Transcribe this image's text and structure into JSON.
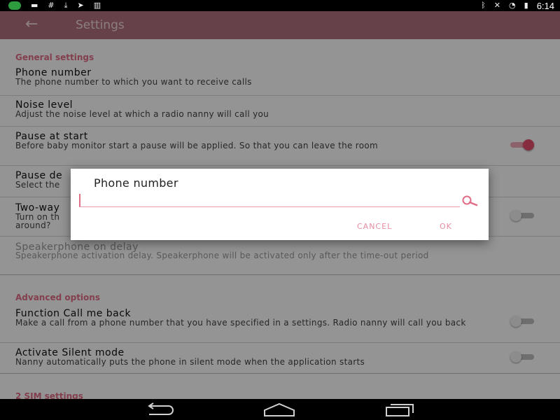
{
  "status_bar": {
    "time": "6:14",
    "left_icons": [
      "app-notification-icon",
      "message-icon",
      "hash-icon",
      "download-icon",
      "send-icon",
      "barcode-icon"
    ],
    "right_icons": [
      "bluetooth-icon",
      "mute-icon",
      "wifi-icon",
      "battery-icon"
    ]
  },
  "app_bar": {
    "title": "Settings",
    "back_icon": "arrow-left-icon"
  },
  "general": {
    "header": "General settings",
    "phone": {
      "title": "Phone number",
      "summary": "The phone number to which you want to receive calls"
    },
    "noise": {
      "title": "Noise level",
      "summary": "Adjust the noise level at which a radio nanny will call you"
    },
    "pause": {
      "title": "Pause at start",
      "summary": "Before baby monitor start a pause will be applied. So that you can leave the room",
      "enabled": true
    },
    "pause_delay": {
      "title": "Pause de",
      "summary": "Select the"
    },
    "two_way": {
      "title": "Two-way",
      "summary": "Turn on th\naround?",
      "enabled": false
    },
    "speaker": {
      "title": "Speakerphone on delay",
      "summary": "Speakerphone activation delay. Speakerphone will be activated only after the time-out period"
    }
  },
  "advanced": {
    "header": "Advanced options",
    "call_back": {
      "title": "Function Call me back",
      "summary": "Make a call from a phone number that you have specified in a settings. Radio nanny will call you back",
      "enabled": false
    },
    "silent": {
      "title": "Activate Silent mode",
      "summary": "Nanny automatically puts the phone in silent mode when the application starts",
      "enabled": false
    }
  },
  "sim": {
    "header": "2 SIM settings"
  },
  "dialog": {
    "title": "Phone number",
    "input_value": "",
    "cancel_label": "CANCEL",
    "ok_label": "OK",
    "search_icon": "search-icon"
  },
  "nav_bar": {
    "icons": [
      "back-icon",
      "home-icon",
      "recents-icon"
    ]
  },
  "colors": {
    "accent": "#e26d86",
    "toggle_on": "#e7506f",
    "app_bar": "#b0707e",
    "dialog_button": "#e78ea2"
  }
}
